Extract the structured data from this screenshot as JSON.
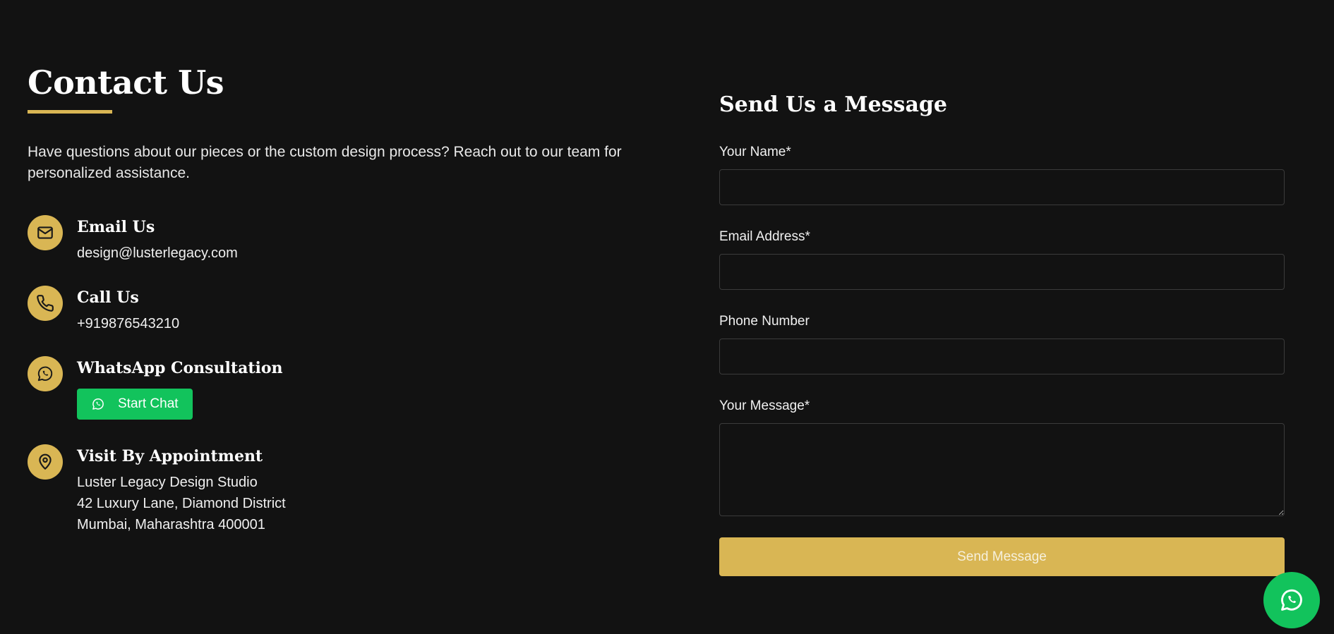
{
  "contact": {
    "title": "Contact Us",
    "intro": "Have questions about our pieces or the custom design process? Reach out to our team for personalized assistance.",
    "email": {
      "title": "Email Us",
      "value": "design@lusterlegacy.com",
      "icon": "mail-icon"
    },
    "call": {
      "title": "Call Us",
      "value": "+919876543210",
      "icon": "phone-icon"
    },
    "whatsapp": {
      "title": "WhatsApp Consultation",
      "button_label": "Start Chat",
      "icon": "whatsapp-icon"
    },
    "visit": {
      "title": "Visit By Appointment",
      "line1": "Luster Legacy Design Studio",
      "line2": "42 Luxury Lane, Diamond District",
      "line3": "Mumbai, Maharashtra 400001",
      "icon": "map-pin-icon"
    }
  },
  "form": {
    "title": "Send Us a Message",
    "name_label": "Your Name*",
    "name_value": "",
    "email_label": "Email Address*",
    "email_value": "",
    "phone_label": "Phone Number",
    "phone_value": "",
    "message_label": "Your Message*",
    "message_value": "",
    "submit_label": "Send Message"
  },
  "colors": {
    "background": "#121212",
    "accent_gold": "#d9b654",
    "whatsapp_green": "#12c35c"
  }
}
